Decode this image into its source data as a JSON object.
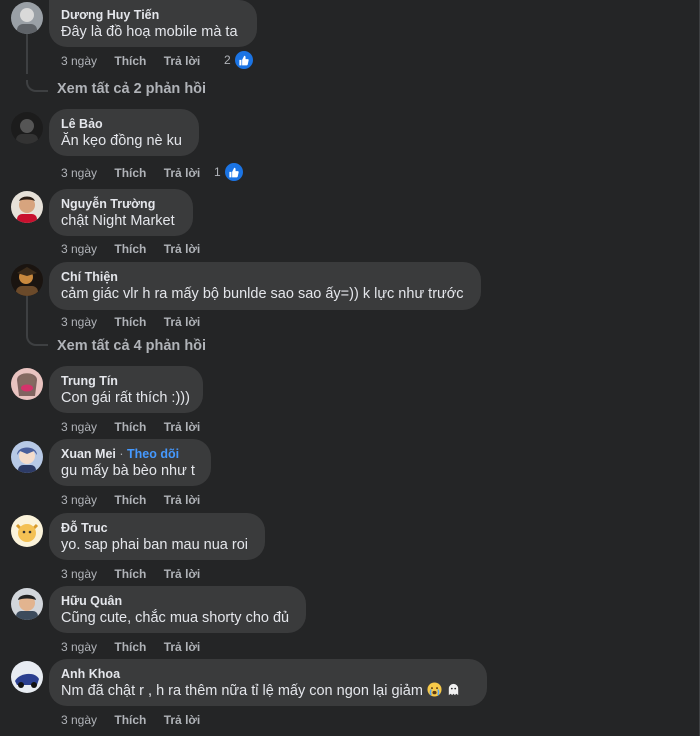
{
  "colors": {
    "background": "#242526",
    "bubble": "#3a3b3c",
    "text": "#e4e6eb",
    "muted": "#b0b3b8",
    "link": "#4599ff",
    "like": "#1b74e4"
  },
  "actions": {
    "time": "3 ngày",
    "like": "Thích",
    "reply": "Trả lời"
  },
  "follow_label": "Theo dõi",
  "comments": [
    {
      "name": "Dương Huy Tiến",
      "text": "Đây là đồ hoạ mobile mà ta",
      "likes": "2"
    },
    {
      "name": "Lê Bảo",
      "text": "Ăn kẹo đồng nè ku",
      "likes": "1"
    },
    {
      "name": "Nguyễn Trường",
      "text": "chật Night Market"
    },
    {
      "name": "Chí Thiện",
      "text": "cảm giác vlr h ra mấy bộ bunlde sao sao ấy=)) k lực như trước"
    },
    {
      "name": "Trung Tín",
      "text": "Con gái rất thích :)))"
    },
    {
      "name": "Xuan Mei",
      "text": "gu mấy bà bèo như t"
    },
    {
      "name": "Đỗ Truc",
      "text": "yo. sap phai ban mau nua roi"
    },
    {
      "name": "Hữu Quân",
      "text": "Cũng cute, chắc mua shorty cho đủ"
    },
    {
      "name": "Anh Khoa",
      "text": "Nm đã chật r , h ra thêm nữa tỉ lệ mấy con ngon lại giảm"
    }
  ],
  "view_replies": [
    "Xem tất cả 2 phản hồi",
    "Xem tất cả 4 phản hồi"
  ],
  "icons": {
    "like": "thumbs-up-icon",
    "emoji_cry": "crying-face-icon",
    "emoji_ghost": "ghost-icon"
  }
}
